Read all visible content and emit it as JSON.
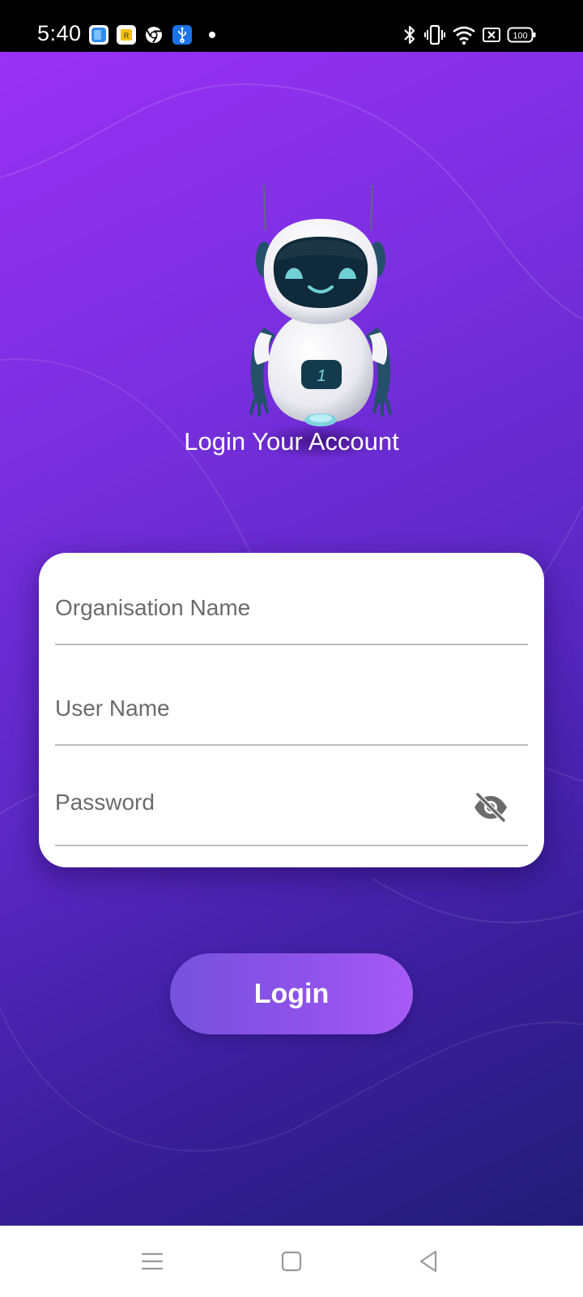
{
  "status_bar": {
    "time": "5:40",
    "notifications": [
      {
        "icon": "files-app-icon",
        "color": "#2f8cf0"
      },
      {
        "icon": "keep-notes-app-icon",
        "color": "#f4c20d"
      },
      {
        "icon": "chrome-app-icon",
        "color": "#ffffff"
      },
      {
        "icon": "usb-debugging-icon",
        "color": "#1a73e8"
      }
    ],
    "system_icons": [
      "bluetooth-icon",
      "vibrate-icon",
      "wifi-icon",
      "no-sim-icon",
      "battery-icon"
    ],
    "battery_level": "100"
  },
  "login": {
    "title": "Login Your Account",
    "organisation_placeholder": "Organisation Name",
    "username_placeholder": "User Name",
    "password_placeholder": "Password",
    "password_toggle_icon": "eye-off-icon",
    "button_label": "Login",
    "robot_badge": "1"
  },
  "nav_bar": {
    "items": [
      "menu-icon",
      "home-icon",
      "back-icon"
    ]
  },
  "colors": {
    "gradient_start": "#9a31f5",
    "gradient_end": "#221c76",
    "button_start": "#7553dc",
    "button_end": "#a65bf5",
    "card": "#ffffff"
  }
}
